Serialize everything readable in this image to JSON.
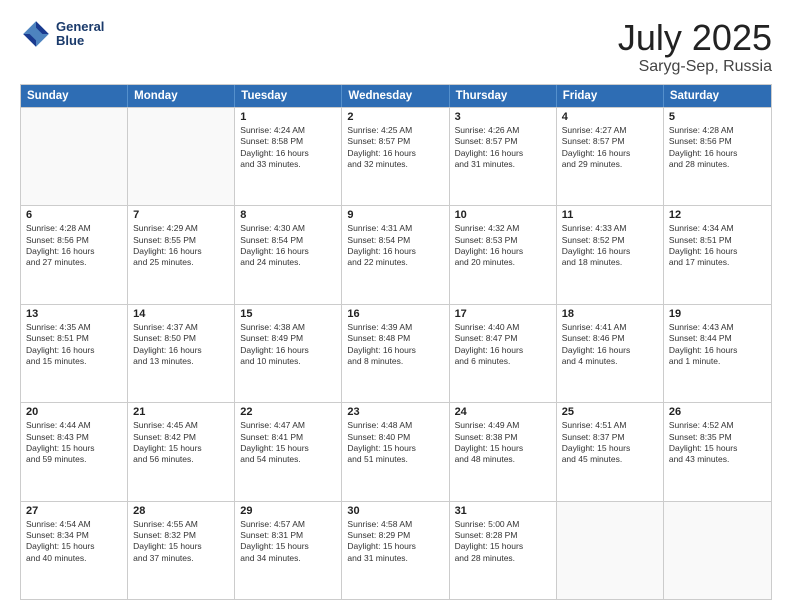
{
  "header": {
    "logo_line1": "General",
    "logo_line2": "Blue",
    "month": "July 2025",
    "location": "Saryg-Sep, Russia"
  },
  "days_of_week": [
    "Sunday",
    "Monday",
    "Tuesday",
    "Wednesday",
    "Thursday",
    "Friday",
    "Saturday"
  ],
  "weeks": [
    [
      {
        "day": "",
        "lines": []
      },
      {
        "day": "",
        "lines": []
      },
      {
        "day": "1",
        "lines": [
          "Sunrise: 4:24 AM",
          "Sunset: 8:58 PM",
          "Daylight: 16 hours",
          "and 33 minutes."
        ]
      },
      {
        "day": "2",
        "lines": [
          "Sunrise: 4:25 AM",
          "Sunset: 8:57 PM",
          "Daylight: 16 hours",
          "and 32 minutes."
        ]
      },
      {
        "day": "3",
        "lines": [
          "Sunrise: 4:26 AM",
          "Sunset: 8:57 PM",
          "Daylight: 16 hours",
          "and 31 minutes."
        ]
      },
      {
        "day": "4",
        "lines": [
          "Sunrise: 4:27 AM",
          "Sunset: 8:57 PM",
          "Daylight: 16 hours",
          "and 29 minutes."
        ]
      },
      {
        "day": "5",
        "lines": [
          "Sunrise: 4:28 AM",
          "Sunset: 8:56 PM",
          "Daylight: 16 hours",
          "and 28 minutes."
        ]
      }
    ],
    [
      {
        "day": "6",
        "lines": [
          "Sunrise: 4:28 AM",
          "Sunset: 8:56 PM",
          "Daylight: 16 hours",
          "and 27 minutes."
        ]
      },
      {
        "day": "7",
        "lines": [
          "Sunrise: 4:29 AM",
          "Sunset: 8:55 PM",
          "Daylight: 16 hours",
          "and 25 minutes."
        ]
      },
      {
        "day": "8",
        "lines": [
          "Sunrise: 4:30 AM",
          "Sunset: 8:54 PM",
          "Daylight: 16 hours",
          "and 24 minutes."
        ]
      },
      {
        "day": "9",
        "lines": [
          "Sunrise: 4:31 AM",
          "Sunset: 8:54 PM",
          "Daylight: 16 hours",
          "and 22 minutes."
        ]
      },
      {
        "day": "10",
        "lines": [
          "Sunrise: 4:32 AM",
          "Sunset: 8:53 PM",
          "Daylight: 16 hours",
          "and 20 minutes."
        ]
      },
      {
        "day": "11",
        "lines": [
          "Sunrise: 4:33 AM",
          "Sunset: 8:52 PM",
          "Daylight: 16 hours",
          "and 18 minutes."
        ]
      },
      {
        "day": "12",
        "lines": [
          "Sunrise: 4:34 AM",
          "Sunset: 8:51 PM",
          "Daylight: 16 hours",
          "and 17 minutes."
        ]
      }
    ],
    [
      {
        "day": "13",
        "lines": [
          "Sunrise: 4:35 AM",
          "Sunset: 8:51 PM",
          "Daylight: 16 hours",
          "and 15 minutes."
        ]
      },
      {
        "day": "14",
        "lines": [
          "Sunrise: 4:37 AM",
          "Sunset: 8:50 PM",
          "Daylight: 16 hours",
          "and 13 minutes."
        ]
      },
      {
        "day": "15",
        "lines": [
          "Sunrise: 4:38 AM",
          "Sunset: 8:49 PM",
          "Daylight: 16 hours",
          "and 10 minutes."
        ]
      },
      {
        "day": "16",
        "lines": [
          "Sunrise: 4:39 AM",
          "Sunset: 8:48 PM",
          "Daylight: 16 hours",
          "and 8 minutes."
        ]
      },
      {
        "day": "17",
        "lines": [
          "Sunrise: 4:40 AM",
          "Sunset: 8:47 PM",
          "Daylight: 16 hours",
          "and 6 minutes."
        ]
      },
      {
        "day": "18",
        "lines": [
          "Sunrise: 4:41 AM",
          "Sunset: 8:46 PM",
          "Daylight: 16 hours",
          "and 4 minutes."
        ]
      },
      {
        "day": "19",
        "lines": [
          "Sunrise: 4:43 AM",
          "Sunset: 8:44 PM",
          "Daylight: 16 hours",
          "and 1 minute."
        ]
      }
    ],
    [
      {
        "day": "20",
        "lines": [
          "Sunrise: 4:44 AM",
          "Sunset: 8:43 PM",
          "Daylight: 15 hours",
          "and 59 minutes."
        ]
      },
      {
        "day": "21",
        "lines": [
          "Sunrise: 4:45 AM",
          "Sunset: 8:42 PM",
          "Daylight: 15 hours",
          "and 56 minutes."
        ]
      },
      {
        "day": "22",
        "lines": [
          "Sunrise: 4:47 AM",
          "Sunset: 8:41 PM",
          "Daylight: 15 hours",
          "and 54 minutes."
        ]
      },
      {
        "day": "23",
        "lines": [
          "Sunrise: 4:48 AM",
          "Sunset: 8:40 PM",
          "Daylight: 15 hours",
          "and 51 minutes."
        ]
      },
      {
        "day": "24",
        "lines": [
          "Sunrise: 4:49 AM",
          "Sunset: 8:38 PM",
          "Daylight: 15 hours",
          "and 48 minutes."
        ]
      },
      {
        "day": "25",
        "lines": [
          "Sunrise: 4:51 AM",
          "Sunset: 8:37 PM",
          "Daylight: 15 hours",
          "and 45 minutes."
        ]
      },
      {
        "day": "26",
        "lines": [
          "Sunrise: 4:52 AM",
          "Sunset: 8:35 PM",
          "Daylight: 15 hours",
          "and 43 minutes."
        ]
      }
    ],
    [
      {
        "day": "27",
        "lines": [
          "Sunrise: 4:54 AM",
          "Sunset: 8:34 PM",
          "Daylight: 15 hours",
          "and 40 minutes."
        ]
      },
      {
        "day": "28",
        "lines": [
          "Sunrise: 4:55 AM",
          "Sunset: 8:32 PM",
          "Daylight: 15 hours",
          "and 37 minutes."
        ]
      },
      {
        "day": "29",
        "lines": [
          "Sunrise: 4:57 AM",
          "Sunset: 8:31 PM",
          "Daylight: 15 hours",
          "and 34 minutes."
        ]
      },
      {
        "day": "30",
        "lines": [
          "Sunrise: 4:58 AM",
          "Sunset: 8:29 PM",
          "Daylight: 15 hours",
          "and 31 minutes."
        ]
      },
      {
        "day": "31",
        "lines": [
          "Sunrise: 5:00 AM",
          "Sunset: 8:28 PM",
          "Daylight: 15 hours",
          "and 28 minutes."
        ]
      },
      {
        "day": "",
        "lines": []
      },
      {
        "day": "",
        "lines": []
      }
    ]
  ]
}
